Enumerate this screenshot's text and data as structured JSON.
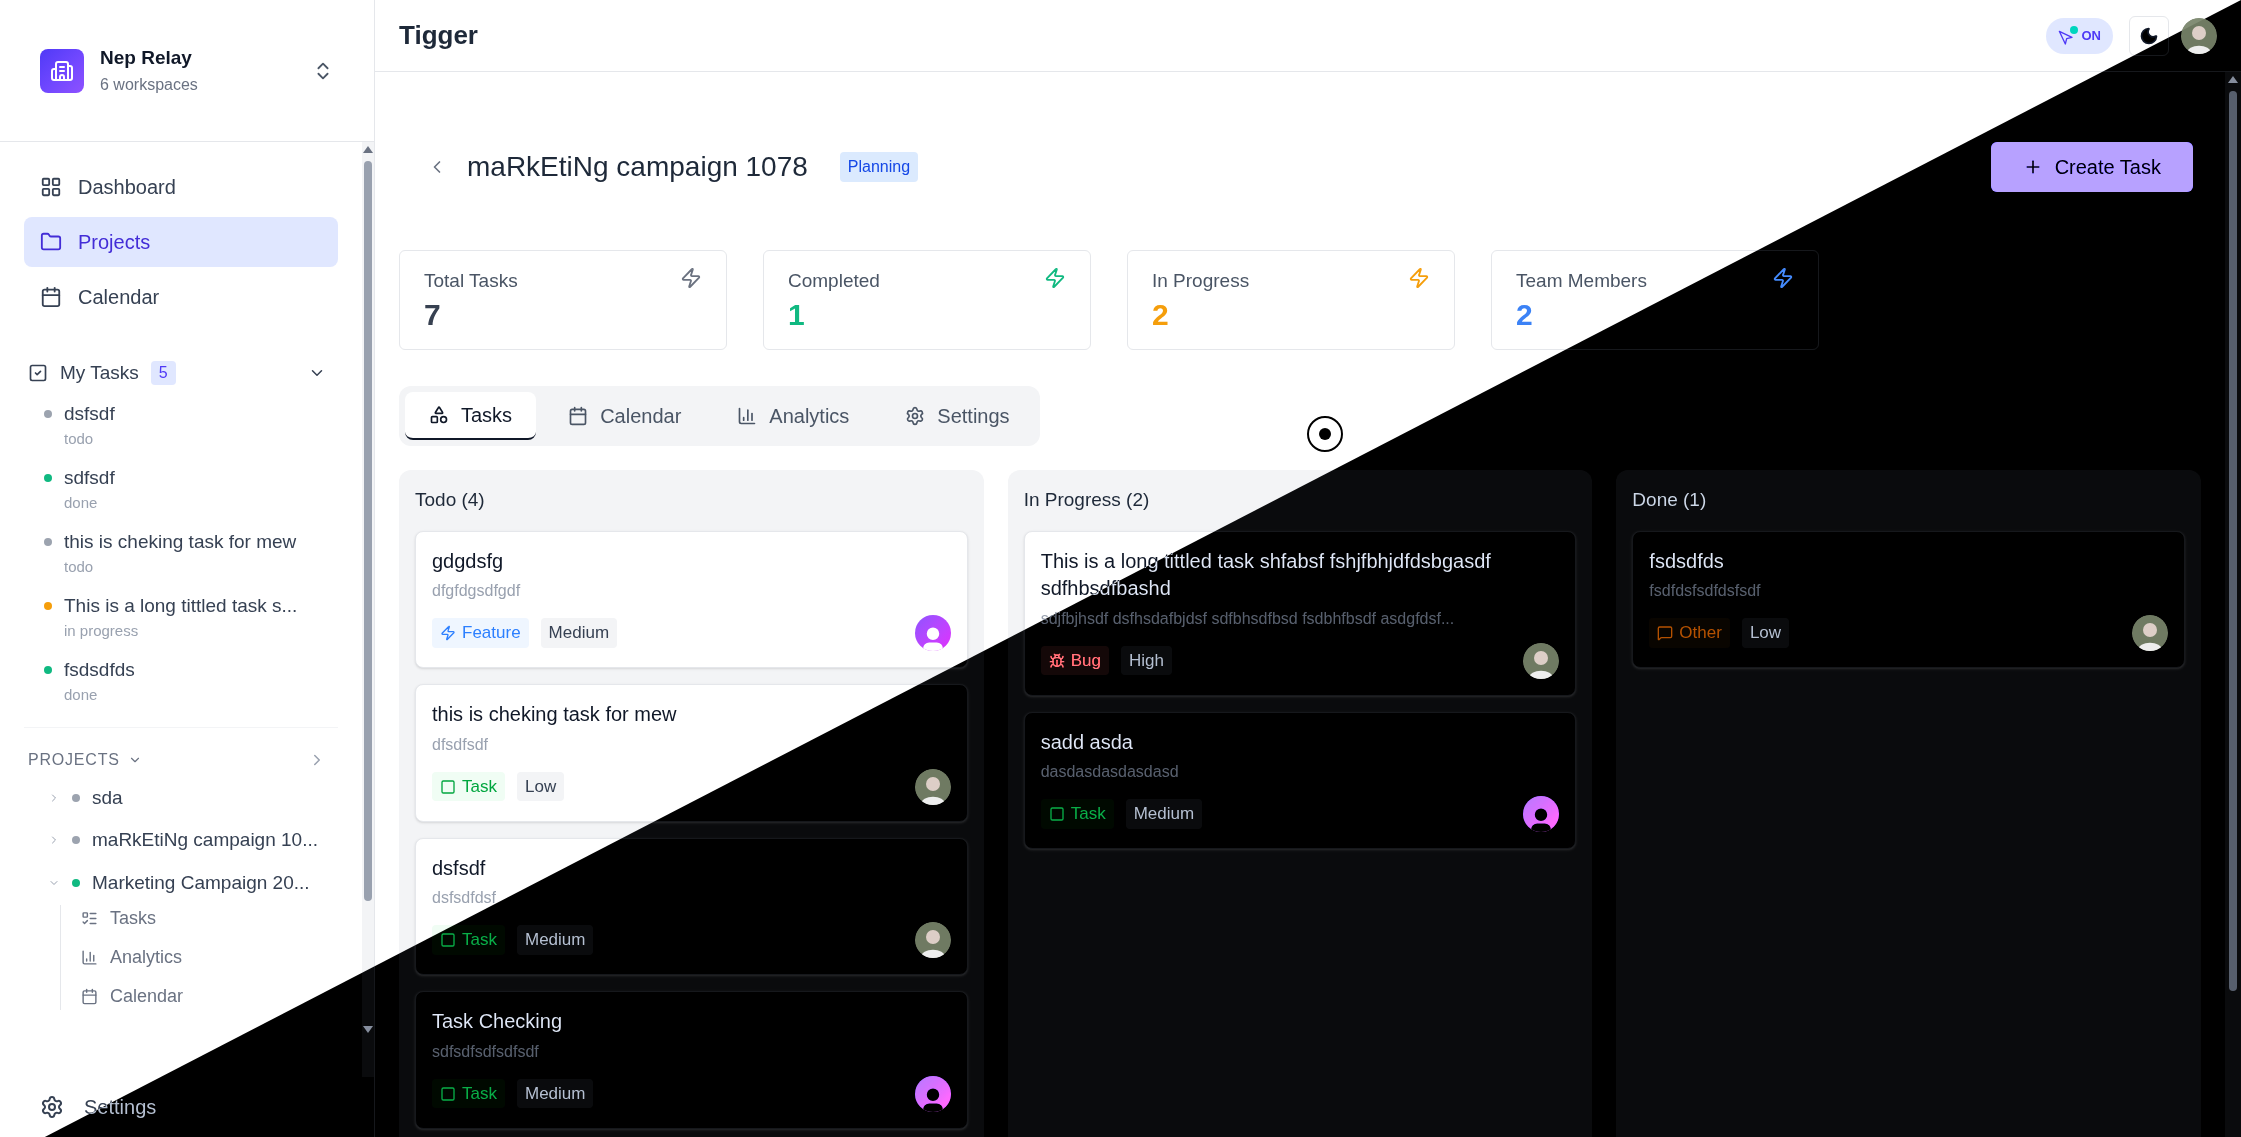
{
  "workspace": {
    "name": "Nep Relay",
    "subtitle": "6 workspaces"
  },
  "nav": [
    {
      "label": "Dashboard",
      "selected": false
    },
    {
      "label": "Projects",
      "selected": true
    },
    {
      "label": "Calendar",
      "selected": false
    }
  ],
  "my_tasks": {
    "label": "My Tasks",
    "count": "5",
    "expanded": true,
    "items": [
      {
        "title": "dsfsdf",
        "status": "todo",
        "color": "#9ca3af"
      },
      {
        "title": "sdfsdf",
        "status": "done",
        "color": "#10b981"
      },
      {
        "title": "this is cheking task for mew",
        "status": "todo",
        "color": "#9ca3af"
      },
      {
        "title": "This is a long tittled task s...",
        "status": "in progress",
        "color": "#f59e0b"
      },
      {
        "title": "fsdsdfds",
        "status": "done",
        "color": "#10b981"
      }
    ]
  },
  "projects": {
    "heading": "PROJECTS",
    "items": [
      {
        "name": "sda",
        "color": "#9ca3af",
        "expanded": false
      },
      {
        "name": "maRkEtiNg campaign 10...",
        "color": "#9ca3af",
        "expanded": false
      },
      {
        "name": "Marketing Campaign 20...",
        "color": "#10b981",
        "expanded": true,
        "children": [
          {
            "label": "Tasks"
          },
          {
            "label": "Analytics"
          },
          {
            "label": "Calendar"
          }
        ]
      }
    ]
  },
  "settings_label": "Settings",
  "header": {
    "title": "Tigger",
    "mode_toggle": "ON"
  },
  "project": {
    "title": "maRkEtiNg campaign 1078",
    "status": "Planning",
    "create_button": "Create Task"
  },
  "stats": [
    {
      "label": "Total Tasks",
      "value": "7",
      "color": "#374151"
    },
    {
      "label": "Completed",
      "value": "1",
      "color": "#10b981"
    },
    {
      "label": "In Progress",
      "value": "2",
      "color": "#f59e0b"
    },
    {
      "label": "Team Members",
      "value": "2",
      "color": "#3b82f6"
    }
  ],
  "tabs": [
    {
      "label": "Tasks",
      "selected": true
    },
    {
      "label": "Calendar",
      "selected": false
    },
    {
      "label": "Analytics",
      "selected": false
    },
    {
      "label": "Settings",
      "selected": false
    }
  ],
  "columns": [
    {
      "title": "Todo (4)",
      "cards": [
        {
          "title": "gdgdsfg",
          "description": "dfgfdgsdfgdf",
          "type": "Feature",
          "kind": "feature",
          "priority": "Medium",
          "avatar": {
            "kind": "default"
          }
        },
        {
          "title": "this is cheking task for mew",
          "description": "dfsdfsdf",
          "type": "Task",
          "kind": "task",
          "priority": "Low"
        },
        {
          "title": "dsfsdf",
          "description": "dsfsdfdsf",
          "type": "Task",
          "kind": "task",
          "priority": "Medium"
        },
        {
          "title": "Task Checking",
          "description": "sdfsdfsdfsdfsdf",
          "type": "Task",
          "kind": "task",
          "priority": "Medium",
          "avatar": {
            "kind": "default"
          }
        }
      ]
    },
    {
      "title": "In Progress (2)",
      "cards": [
        {
          "title": "This is a long tittled task shfabsf fshjfbhjdfdsbgasdf sdfhbsdfbashd",
          "description": "sdjfbjhsdf dsfhsdafbjdsf sdfbhsdfbsd fsdbhfbsdf asdgfdsf...",
          "type": "Bug",
          "kind": "bug",
          "priority": "High"
        },
        {
          "title": "sadd asda",
          "description": "dasdasdasdasdasd",
          "type": "Task",
          "kind": "task",
          "priority": "Medium",
          "avatar": {
            "kind": "default"
          }
        }
      ]
    },
    {
      "title": "Done (1)",
      "cards": [
        {
          "title": "fsdsdfds",
          "description": "fsdfdsfsdfdsfsdf",
          "type": "Other",
          "kind": "other",
          "priority": "Low"
        }
      ]
    }
  ]
}
